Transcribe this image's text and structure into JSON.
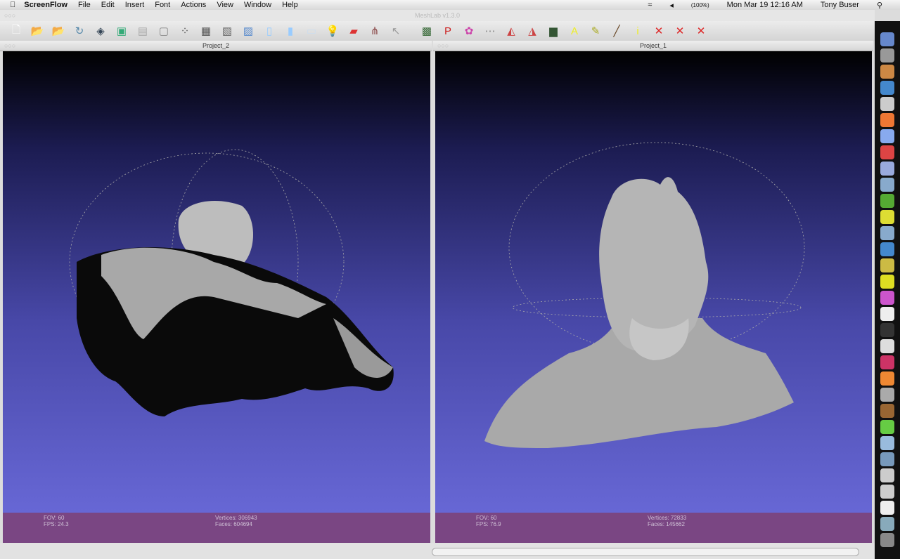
{
  "menubar": {
    "app": "ScreenFlow",
    "items": [
      "File",
      "Edit",
      "Insert",
      "Font",
      "Actions",
      "View",
      "Window",
      "Help"
    ],
    "battery": "(100%)",
    "clock": "Mon Mar 19  12:16 AM",
    "user": "Tony Buser"
  },
  "window": {
    "title": "MeshLab v1.3.0"
  },
  "toolbar": {
    "icons": [
      "new-icon",
      "open-icon",
      "open-project-icon",
      "reload-icon",
      "export-icon",
      "snapshot-icon",
      "layers-icon",
      "bbox-icon",
      "points-icon",
      "wireframe-icon",
      "hidden-lines-icon",
      "flat-lines-icon",
      "flat-icon",
      "smooth-icon",
      "texture-icon",
      "light-icon",
      "backface-icon",
      "normals-icon",
      "pointer-icon",
      "color-icon",
      "pick-icon",
      "paint-icon",
      "select-icon",
      "select-faces-icon",
      "select-vertices-icon",
      "texture-map-icon",
      "annotate-icon",
      "measure-icon",
      "brush-icon",
      "info-icon",
      "delete-faces-icon",
      "delete-vertices-icon",
      "delete-selection-icon"
    ]
  },
  "views": [
    {
      "title": "Project_2",
      "fov_label": "FOV: 60",
      "fps_label": "FPS:   24.3",
      "vertices_label": "Vertices: 306943",
      "faces_label": "Faces: 604694"
    },
    {
      "title": "Project_1",
      "fov_label": "FOV: 60",
      "fps_label": "FPS:   76.9",
      "vertices_label": "Vertices: 72833",
      "faces_label": "Faces: 145662"
    }
  ]
}
